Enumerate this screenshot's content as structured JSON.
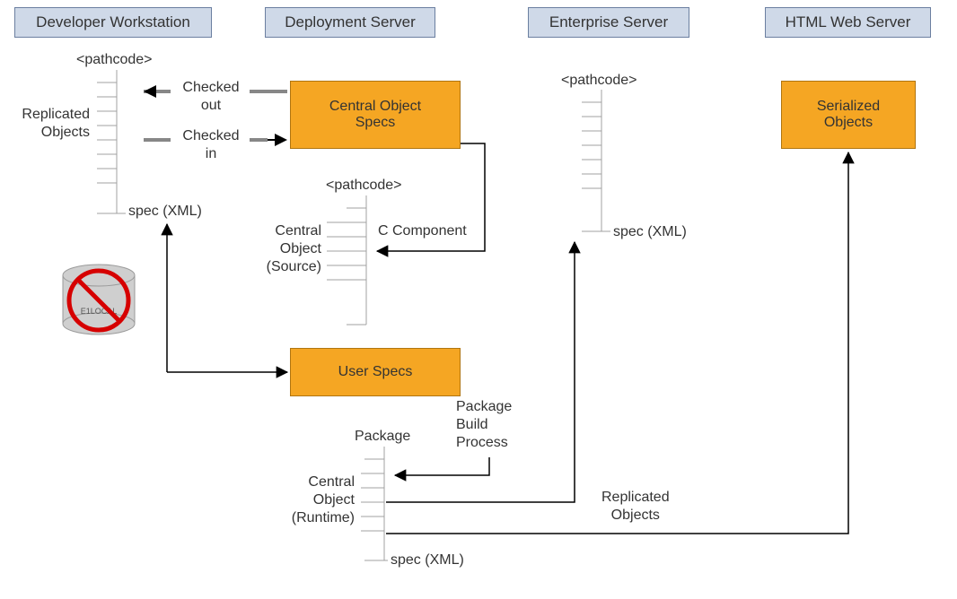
{
  "headers": {
    "dev": "Developer Workstation",
    "deploy": "Deployment Server",
    "ent": "Enterprise Server",
    "web": "HTML Web Server"
  },
  "boxes": {
    "central_specs": "Central Object\nSpecs",
    "user_specs": "User Specs",
    "serialized": "Serialized\nObjects"
  },
  "labels": {
    "pathcode_dev": "<pathcode>",
    "pathcode_deploy": "<pathcode>",
    "pathcode_ent": "<pathcode>",
    "replicated_objects_left": "Replicated\nObjects",
    "checked_out": "Checked\nout",
    "checked_in": "Checked\nin",
    "spec_xml_dev": "spec (XML)",
    "central_object_source": "Central\nObject\n(Source)",
    "c_component": "C Component",
    "spec_xml_ent": "spec (XML)",
    "package": "Package",
    "central_object_runtime": "Central\nObject\n(Runtime)",
    "spec_xml_pkg": "spec (XML)",
    "package_build_process": "Package\nBuild\nProcess",
    "replicated_objects_right": "Replicated\nObjects",
    "e1local": "E1LOCAL"
  },
  "colors": {
    "header_fill": "#cfd9e8",
    "header_border": "#6b7fa0",
    "box_fill": "#f5a623",
    "box_border": "#b07510",
    "line": "#000000",
    "dash": "#878787",
    "tick": "#a0a0a0",
    "db_fill": "#cfcfcf",
    "db_stroke": "#9a9a9a",
    "no_circle": "#d60000"
  }
}
